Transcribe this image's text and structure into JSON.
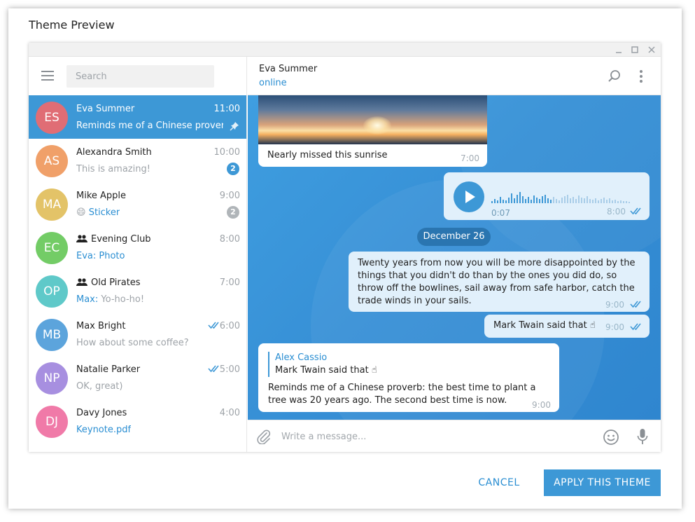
{
  "dialog": {
    "title": "Theme Preview",
    "cancel_label": "CANCEL",
    "apply_label": "APPLY THIS THEME"
  },
  "window": {
    "controls": [
      "minimize-icon",
      "maximize-icon",
      "close-icon"
    ]
  },
  "sidebar": {
    "search_placeholder": "Search",
    "chats": [
      {
        "initials": "ES",
        "name": "Eva Summer",
        "time": "11:00",
        "preview": "Reminds me of a Chinese prover…",
        "pinned": true,
        "active": true,
        "avatar_color": "#e06d75"
      },
      {
        "initials": "AS",
        "name": "Alexandra Smith",
        "time": "10:00",
        "preview": "This is amazing!",
        "unread": "2",
        "avatar_color": "#f0a069"
      },
      {
        "initials": "MA",
        "name": "Mike Apple",
        "time": "9:00",
        "preview_emoji": "😄",
        "preview": "Sticker",
        "unread": "2",
        "unread_muted": true,
        "avatar_color": "#e3c368"
      },
      {
        "initials": "EC",
        "name": "Evening Club",
        "time": "8:00",
        "preview": "Eva: Photo",
        "group": true,
        "avatar_color": "#73cc66"
      },
      {
        "initials": "OP",
        "name": "Old Pirates",
        "time": "7:00",
        "sender": "Max:",
        "preview": "Yo-ho-ho!",
        "group": true,
        "avatar_color": "#5fc9c9"
      },
      {
        "initials": "MB",
        "name": "Max Bright",
        "time": "6:00",
        "preview": "How about some coffee?",
        "read_ticks": true,
        "avatar_color": "#5ca4dc"
      },
      {
        "initials": "NP",
        "name": "Natalie Parker",
        "time": "5:00",
        "preview": "OK, great)",
        "read_ticks": true,
        "avatar_color": "#a78fe0"
      },
      {
        "initials": "DJ",
        "name": "Davy Jones",
        "time": "4:00",
        "preview": "Keynote.pdf",
        "avatar_color": "#f07aa8"
      }
    ]
  },
  "conversation": {
    "name": "Eva Summer",
    "status": "online",
    "photo_caption": "Nearly missed this sunrise",
    "photo_time": "7:00",
    "voice_duration": "0:07",
    "voice_time": "8:00",
    "date_separator": "December 26",
    "quote_text": "Twenty years from now you will be more disappointed by the things that you didn't do than by the ones you did do, so throw off the bowlines, sail away from safe harbor, catch the trade winds in your sails.",
    "quote_time": "9:00",
    "mark_text": "Mark Twain said that ☝",
    "mark_time": "9:00",
    "reply_name": "Alex Cassio",
    "reply_quoted": "Mark Twain said that ☝",
    "reply_text": "Reminds me of a Chinese proverb: the best time to plant a tree was 20 years ago. The second best time is now.",
    "reply_time": "9:00",
    "composer_placeholder": "Write a message..."
  },
  "colors": {
    "accent": "#3d98d6",
    "link": "#2a8ed2",
    "outgoing_bubble": "#e1f0fb",
    "chat_background": "#3790d6"
  }
}
